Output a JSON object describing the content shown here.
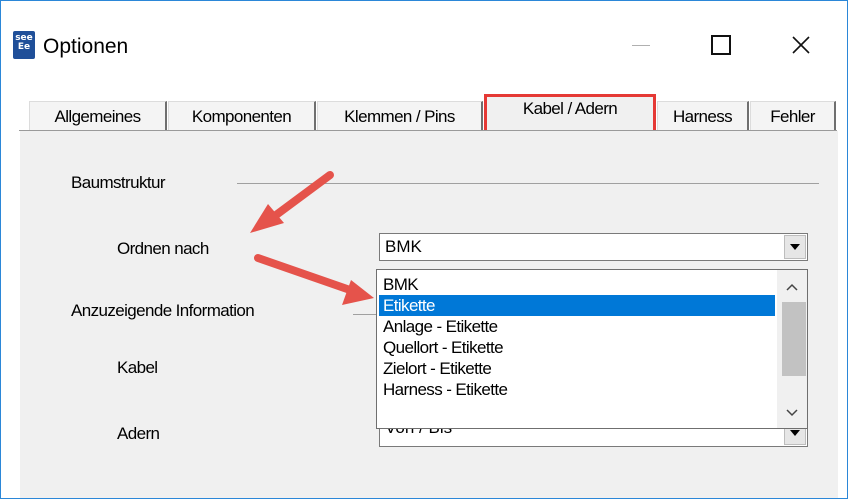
{
  "window": {
    "app_icon_text": [
      "see",
      "Ee"
    ],
    "title": "Optionen"
  },
  "tabs": [
    {
      "label": "Allgemeines"
    },
    {
      "label": "Komponenten"
    },
    {
      "label": "Klemmen / Pins"
    },
    {
      "label": "Kabel / Adern"
    },
    {
      "label": "Harness"
    },
    {
      "label": "Fehler"
    }
  ],
  "active_tab": "Kabel / Adern",
  "panel": {
    "baumstruktur_label": "Baumstruktur",
    "ordnen_nach_label": "Ordnen nach",
    "ordnen_nach_value": "BMK",
    "anzuzeigende_label": "Anzuzeigende Information",
    "kabel_label": "Kabel",
    "adern_label": "Adern",
    "adern_value": "Von / Bis"
  },
  "dropdown": {
    "selected": "Etikette",
    "options": [
      "BMK",
      "Etikette",
      "Anlage - Etikette",
      "Quellort - Etikette",
      "Zielort - Etikette",
      "Harness - Etikette"
    ]
  },
  "colors": {
    "highlight_border": "#e53935",
    "selection": "#0078d7",
    "annotation_arrow": "#e5534b",
    "window_border": "#2b87d8"
  }
}
